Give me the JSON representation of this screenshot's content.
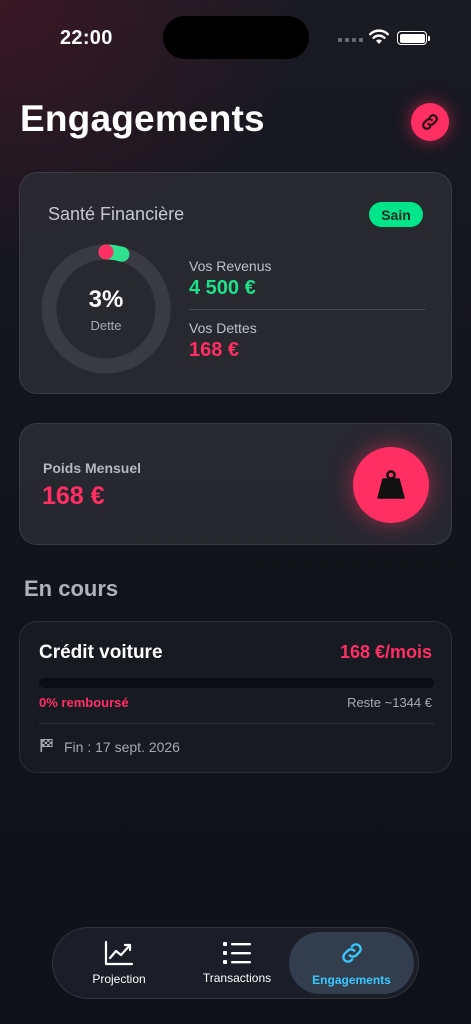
{
  "status_bar": {
    "time": "22:00"
  },
  "header": {
    "title": "Engagements"
  },
  "health": {
    "title": "Santé Financière",
    "badge": "Sain",
    "debt_percent": "3%",
    "debt_ratio": 0.03,
    "ring_label": "Dette",
    "income_label": "Vos Revenus",
    "income_value": "4 500 €",
    "debts_label": "Vos Dettes",
    "debts_value": "168 €"
  },
  "monthly_weight": {
    "label": "Poids Mensuel",
    "value": "168 €"
  },
  "in_progress": {
    "section_title": "En cours",
    "items": [
      {
        "name": "Crédit voiture",
        "monthly": "168 €/mois",
        "progress": 0,
        "paid_label": "0% remboursé",
        "remaining": "Reste ~1344 €",
        "end_date": "Fin : 17 sept. 2026"
      }
    ]
  },
  "tabbar": {
    "tabs": [
      {
        "label": "Projection",
        "icon": "chart-line-icon"
      },
      {
        "label": "Transactions",
        "icon": "list-icon"
      },
      {
        "label": "Engagements",
        "icon": "link-icon",
        "active": true
      }
    ]
  },
  "colors": {
    "accent": "#ff2e63",
    "positive": "#1fe08a",
    "active_tab": "#39c9ff"
  }
}
